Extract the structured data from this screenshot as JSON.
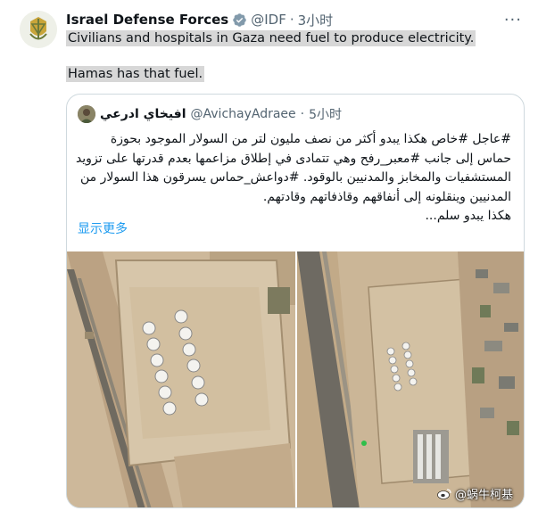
{
  "tweet": {
    "author_name": "Israel Defense Forces",
    "handle": "@IDF",
    "separator": "·",
    "time": "3小时",
    "more_icon": "ellipsis-icon",
    "text_line1": "Civilians and hospitals in Gaza need fuel to produce electricity.",
    "text_line2": "Hamas has that fuel."
  },
  "quote": {
    "author_name": "افيخاي ادرعي",
    "handle": "@AvichayAdraee",
    "separator": "·",
    "time": "5小时",
    "body": "#عاجل #خاص هكذا يبدو أكثر من نصف مليون لتر من السولار الموجود بحوزة حماس إلى جانب #معبر_رفح وهي تتمادى في إطلاق مزاعمها بعدم قدرتها على تزويد المستشفيات والمخابز والمدنيين بالوقود. #دواعش_حماس يسرقون هذا السولار من المدنيين وينقلونه إلى أنفاقهم وقاذفاتهم وقادتهم.\nهكذا يبدو سلم...",
    "show_more": "显示更多"
  },
  "images": [
    {
      "description": "satellite-fuel-tanks-left"
    },
    {
      "description": "satellite-fuel-tanks-right"
    }
  ],
  "watermark": {
    "text": "@蜗牛柯基"
  },
  "colors": {
    "link": "#1d9bf0",
    "verified": "#829aab",
    "highlight": "#d7d7d7"
  }
}
